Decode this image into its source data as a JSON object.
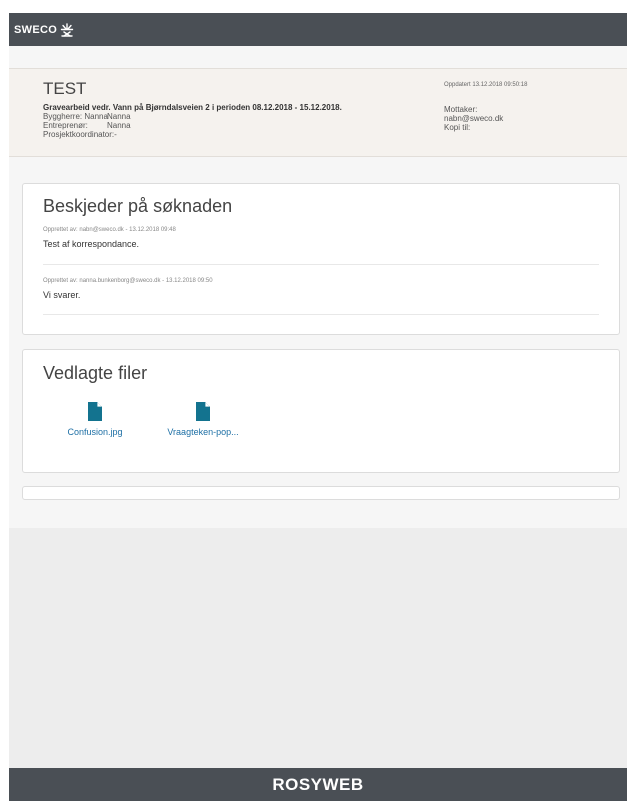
{
  "brand": {
    "logo_text": "SWECO"
  },
  "application": {
    "title": "TEST",
    "description": "Gravearbeid vedr. Vann på Bjørndalsveien 2 i perioden 08.12.2018 - 15.12.2018.",
    "byggherre_label": "Byggherre: Nanna",
    "byggherre_value": "Nanna",
    "entreprenor_label": "Entreprenør:",
    "entreprenor_value": "Nanna",
    "prosjektkoordinator": "Prosjektkoordinator:-",
    "updated": "Oppdatert 13.12.2018 09:50:18",
    "mottaker_label": "Mottaker:",
    "mottaker_value": "nabn@sweco.dk",
    "kopi_label": "Kopi til:"
  },
  "messages": {
    "title": "Beskjeder på søknaden",
    "items": [
      {
        "meta": "Opprettet av: nabn@sweco.dk - 13.12.2018 09:48",
        "text": "Test af korrespondance."
      },
      {
        "meta": "Opprettet av: nanna.bunkenborg@sweco.dk - 13.12.2018 09:50",
        "text": "Vi svarer."
      }
    ]
  },
  "attachments": {
    "title": "Vedlagte filer",
    "files": [
      {
        "name": "Confusion.jpg",
        "icon": "file-icon"
      },
      {
        "name": "Vraagteken-pop...",
        "icon": "file-icon"
      }
    ]
  },
  "footer": {
    "brand": "ROSYWEB"
  },
  "colors": {
    "topbar": "#4a4f55",
    "file_icon": "#13738f",
    "link": "#1d6fa5"
  }
}
